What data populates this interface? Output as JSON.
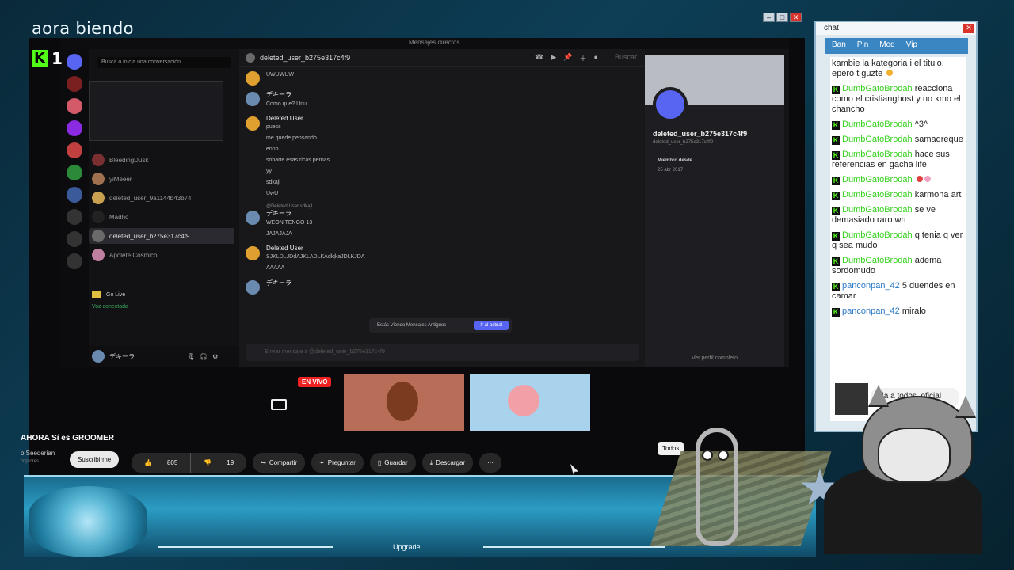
{
  "overlay": {
    "title": "aora biendo",
    "viewer_count": "1",
    "kick_logo": "K"
  },
  "discord": {
    "window_title": "Mensajes directos",
    "search_placeholder": "Busca o inicia una conversación",
    "dm_list": [
      {
        "name": "BleedingDusk",
        "color": "#7a3030"
      },
      {
        "name": "yiMeeer",
        "color": "#a07050"
      },
      {
        "name": "deleted_user_9a1144b43b74",
        "color": "#c9a050"
      },
      {
        "name": "Madho",
        "color": "#222"
      },
      {
        "name": "deleted_user_b275e317c4f9",
        "color": "#6a6a6a",
        "active": true
      },
      {
        "name": "Apolete Cósmico",
        "color": "#c080a0"
      }
    ],
    "go_live": "Go Live",
    "voice_connected": "Voz conectada",
    "current_user": "デキーラ",
    "chat_header_user": "deleted_user_b275e317c4f9",
    "header_search": "Buscar",
    "messages": [
      {
        "author": "",
        "lines": [
          "UWUWUW"
        ],
        "color": "#e0a030"
      },
      {
        "author": "デキーラ",
        "lines": [
          "Como que? Unu"
        ],
        "color": "#6a8ab0"
      },
      {
        "author": "Deleted User",
        "lines": [
          "puess",
          "me quede pensando",
          "enno",
          "sobarte esas ricas pernas",
          "yy",
          "sdkajl",
          "UwU"
        ],
        "color": "#e0a030"
      },
      {
        "author": "デキーラ",
        "reply": "@Deleted User sdkajl",
        "lines": [
          "WEON TENGO 13",
          "JAJAJAJA"
        ],
        "color": "#6a8ab0"
      },
      {
        "author": "Deleted User",
        "lines": [
          "SJKLDLJDdAJKLADLKAdkjkaJDLKJDA",
          "AAAAA"
        ],
        "color": "#e0a030"
      },
      {
        "author": "デキーラ",
        "lines": [],
        "color": "#6a8ab0"
      }
    ],
    "old_messages_text": "Estás Viendo Mensajes Antiguos",
    "goto_current": "Ir al actual",
    "input_placeholder": "Enviar mensaje a @deleted_user_b275e317c4f9",
    "profile": {
      "name": "deleted_user_b275e317c4f9",
      "sub": "deleted_user_b275e317c4f9",
      "member_since_label": "Miembro desde",
      "member_since": "25 abr 2017",
      "view_full": "Ver perfil completo"
    }
  },
  "stream": {
    "live_badge": "EN VIVO"
  },
  "youtube": {
    "title": "AHORA Sí es GROOMER",
    "channel": "o Seederian",
    "subs": "criptores",
    "subscribe": "Suscribirme",
    "likes": "805",
    "dislikes": "19",
    "share": "Compartir",
    "ask": "Preguntar",
    "save": "Guardar",
    "download": "Descargar",
    "more": "···",
    "filter_chip": "Todos"
  },
  "taskbar": {
    "upgrade": "Upgrade"
  },
  "chat": {
    "title": "chat",
    "tabs": [
      "Ban",
      "Pin",
      "Mod",
      "Vip"
    ],
    "messages": [
      {
        "user": "",
        "text": "kambie la kategoria i el titulo, epero t guzte",
        "user_color": "green",
        "emoji": "#f0b030"
      },
      {
        "user": "DumbGatoBrodah",
        "text": "reacciona como el cristianghost y no kmo el chancho",
        "user_color": "green"
      },
      {
        "user": "DumbGatoBrodah",
        "text": "^3^",
        "user_color": "green"
      },
      {
        "user": "DumbGatoBrodah",
        "text": "samadreque",
        "user_color": "green"
      },
      {
        "user": "DumbGatoBrodah",
        "text": "hace sus referencias en gacha life",
        "user_color": "green"
      },
      {
        "user": "DumbGatoBrodah",
        "text": "",
        "user_color": "green",
        "emoji": "#e04040"
      },
      {
        "user": "DumbGatoBrodah",
        "text": "karmona art",
        "user_color": "green"
      },
      {
        "user": "DumbGatoBrodah",
        "text": "se ve demasiado raro wn",
        "user_color": "green"
      },
      {
        "user": "DumbGatoBrodah",
        "text": "q tenia q ver q sea mudo",
        "user_color": "green"
      },
      {
        "user": "DumbGatoBrodah",
        "text": "adema sordomudo",
        "user_color": "green"
      },
      {
        "user": "panconpan_42",
        "text": "5 duendes en camar",
        "user_color": "blue"
      },
      {
        "user": "panconpan_42",
        "text": "miralo",
        "user_color": "blue"
      }
    ],
    "bubble_text": "ola a todos, oficial"
  },
  "colors": {
    "kick_green": "#53fc18",
    "discord_blurple": "#5865f2",
    "live_red": "#ee2222"
  }
}
